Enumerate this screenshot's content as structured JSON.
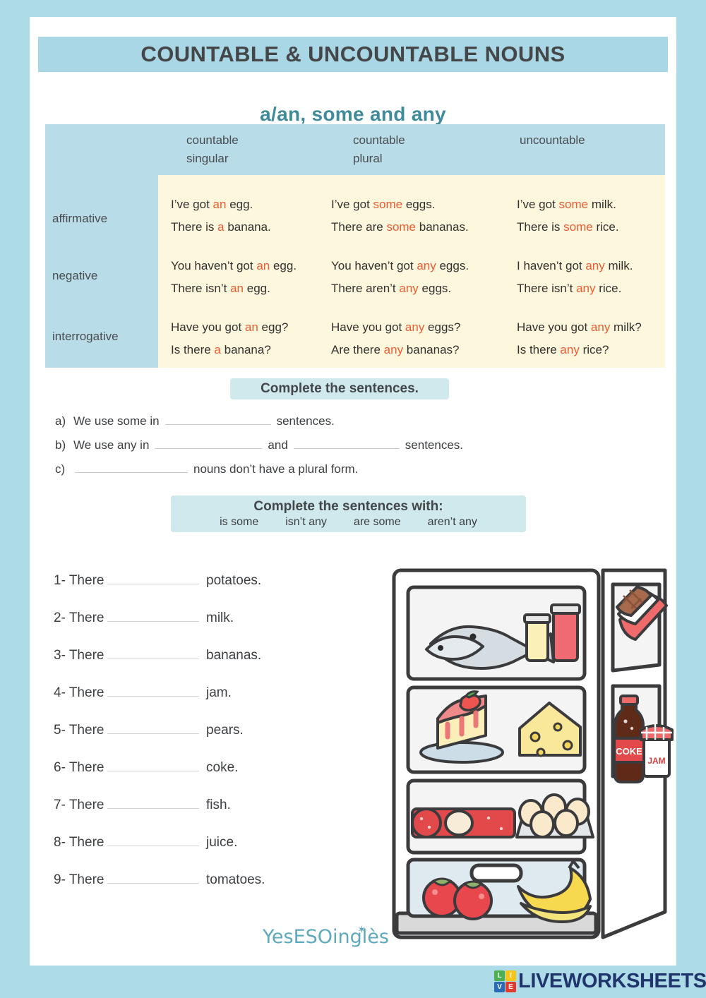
{
  "page": {
    "title": "COUNTABLE & UNCOUNTABLE NOUNS",
    "subtitle": "a/an, some and any"
  },
  "table": {
    "column_headers": [
      {
        "line1": "countable",
        "line2": "singular"
      },
      {
        "line1": "countable",
        "line2": "plural"
      },
      {
        "line1": "uncountable",
        "line2": ""
      }
    ],
    "row_labels": [
      "affirmative",
      "negative",
      "interrogative"
    ],
    "cells": {
      "affirmative": {
        "countable_singular": [
          {
            "pre": "I’ve got ",
            "hl": "an",
            "post": " egg."
          },
          {
            "pre": "There is ",
            "hl": "a",
            "post": " banana."
          }
        ],
        "countable_plural": [
          {
            "pre": "I’ve got ",
            "hl": "some",
            "post": " eggs."
          },
          {
            "pre": "There are ",
            "hl": "some",
            "post": " bananas."
          }
        ],
        "uncountable": [
          {
            "pre": "I’ve got ",
            "hl": "some",
            "post": " milk."
          },
          {
            "pre": "There is ",
            "hl": "some",
            "post": " rice."
          }
        ]
      },
      "negative": {
        "countable_singular": [
          {
            "pre": "You haven’t got ",
            "hl": "an",
            "post": " egg."
          },
          {
            "pre": "There isn’t ",
            "hl": "an",
            "post": " egg."
          }
        ],
        "countable_plural": [
          {
            "pre": "You haven’t got ",
            "hl": "any",
            "post": " eggs."
          },
          {
            "pre": "There aren’t ",
            "hl": "any",
            "post": " eggs."
          }
        ],
        "uncountable": [
          {
            "pre": "I haven’t got ",
            "hl": "any",
            "post": " milk."
          },
          {
            "pre": "There isn’t ",
            "hl": "any",
            "post": " rice."
          }
        ]
      },
      "interrogative": {
        "countable_singular": [
          {
            "pre": "Have you got ",
            "hl": "an",
            "post": " egg?"
          },
          {
            "pre": "Is there ",
            "hl": "a",
            "post": " banana?"
          }
        ],
        "countable_plural": [
          {
            "pre": "Have you got ",
            "hl": "any",
            "post": " eggs?"
          },
          {
            "pre": "Are there ",
            "hl": "any",
            "post": " bananas?"
          }
        ],
        "uncountable": [
          {
            "pre": "Have you got ",
            "hl": "any",
            "post": " milk?"
          },
          {
            "pre": "Is there ",
            "hl": "any",
            "post": " rice?"
          }
        ]
      }
    }
  },
  "exercise1": {
    "instruction": "Complete the sentences.",
    "items": [
      {
        "marker": "a)",
        "part1": "We use some in",
        "part2": "sentences.",
        "part3": ""
      },
      {
        "marker": "b)",
        "part1": "We use any in",
        "part2": "and",
        "part3": "sentences."
      },
      {
        "marker": "c)",
        "part1": "",
        "part2": "nouns don’t have a plural form.",
        "part3": ""
      }
    ]
  },
  "exercise2": {
    "instruction": "Complete the sentences with:",
    "word_bank": [
      "is some",
      "isn’t any",
      "are some",
      "aren’t any"
    ],
    "items": [
      {
        "num": "1- There",
        "word": "potatoes."
      },
      {
        "num": "2- There",
        "word": "milk."
      },
      {
        "num": "3- There",
        "word": "bananas."
      },
      {
        "num": "4- There",
        "word": "jam."
      },
      {
        "num": "5- There",
        "word": "pears."
      },
      {
        "num": "6- There",
        "word": "coke."
      },
      {
        "num": "7- There",
        "word": "fish."
      },
      {
        "num": "8- There",
        "word": "juice."
      },
      {
        "num": "9- There",
        "word": "tomatoes."
      }
    ]
  },
  "illustration": {
    "name": "open-refrigerator-with-food",
    "labels": {
      "coke": "COKE",
      "jam": "JAM"
    },
    "items": [
      "fish",
      "jars",
      "cheesecake",
      "cheese",
      "salami",
      "eggs",
      "tomatoes",
      "bananas",
      "chocolate",
      "coke bottle",
      "jam jar"
    ]
  },
  "footer": {
    "brand": "YesESOinglès",
    "brand_star": "✶",
    "liveworksheets": {
      "tiles": [
        "LI",
        "I",
        "VE",
        "E"
      ],
      "tile_letters": [
        "L",
        "I",
        "V",
        "E"
      ],
      "text": "LIVEWORKSHEETS"
    }
  },
  "colors": {
    "page_border": "#addbe8",
    "title_bg": "#a9d7e5",
    "subtitle": "#3f8a9b",
    "table_blue": "#b8dce8",
    "table_cream": "#fcf7dd",
    "highlight": "#ef5b32",
    "badge_bg": "#cfe9ec",
    "brand": "#5fa9bd",
    "lws_navy": "#20356b"
  }
}
